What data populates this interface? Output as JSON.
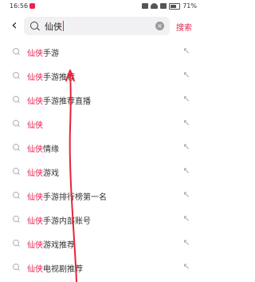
{
  "status_bar": {
    "time": "16:56",
    "battery": "71%"
  },
  "search": {
    "value": "仙侠",
    "submit_label": "搜索",
    "clear_glyph": "×"
  },
  "back_glyph": "‹",
  "fill_glyph": "↖",
  "highlight": "仙侠",
  "suggestions": [
    {
      "rest": "手游"
    },
    {
      "rest": "手游推荐"
    },
    {
      "rest": "手游推荐直播"
    },
    {
      "rest": ""
    },
    {
      "rest": "情缘"
    },
    {
      "rest": "游戏"
    },
    {
      "rest": "手游排行榜第一名"
    },
    {
      "rest": "手游内部账号"
    },
    {
      "rest": "游戏推荐"
    },
    {
      "rest": "电视剧推荐"
    }
  ],
  "colors": {
    "accent": "#e8244f",
    "annotation": "#e8243a"
  }
}
